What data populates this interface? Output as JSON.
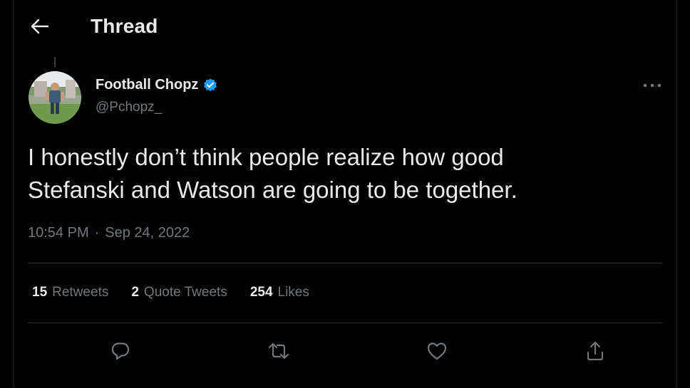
{
  "header": {
    "title": "Thread",
    "back_icon": "arrow-left-icon"
  },
  "tweet": {
    "author": {
      "name": "Football Chopz",
      "handle": "@Pchopz_",
      "verified": true,
      "verified_color": "#1d9bf0"
    },
    "text_lines": [
      "I honestly don’t think people realize how good",
      "Stefanski and Watson are going to be together."
    ],
    "time": "10:54 PM",
    "separator": "·",
    "date": "Sep 24, 2022"
  },
  "stats": {
    "retweets": {
      "count": "15",
      "label": "Retweets"
    },
    "quote_tweets": {
      "count": "2",
      "label": "Quote Tweets"
    },
    "likes": {
      "count": "254",
      "label": "Likes"
    }
  },
  "actions": {
    "reply_icon": "reply-icon",
    "retweet_icon": "retweet-icon",
    "like_icon": "heart-icon",
    "share_icon": "share-icon",
    "more_icon": "more-icon"
  },
  "colors": {
    "background": "#000000",
    "text_primary": "#e7e9ea",
    "text_secondary": "#71767b",
    "divider": "#2f3336",
    "accent": "#1d9bf0"
  }
}
